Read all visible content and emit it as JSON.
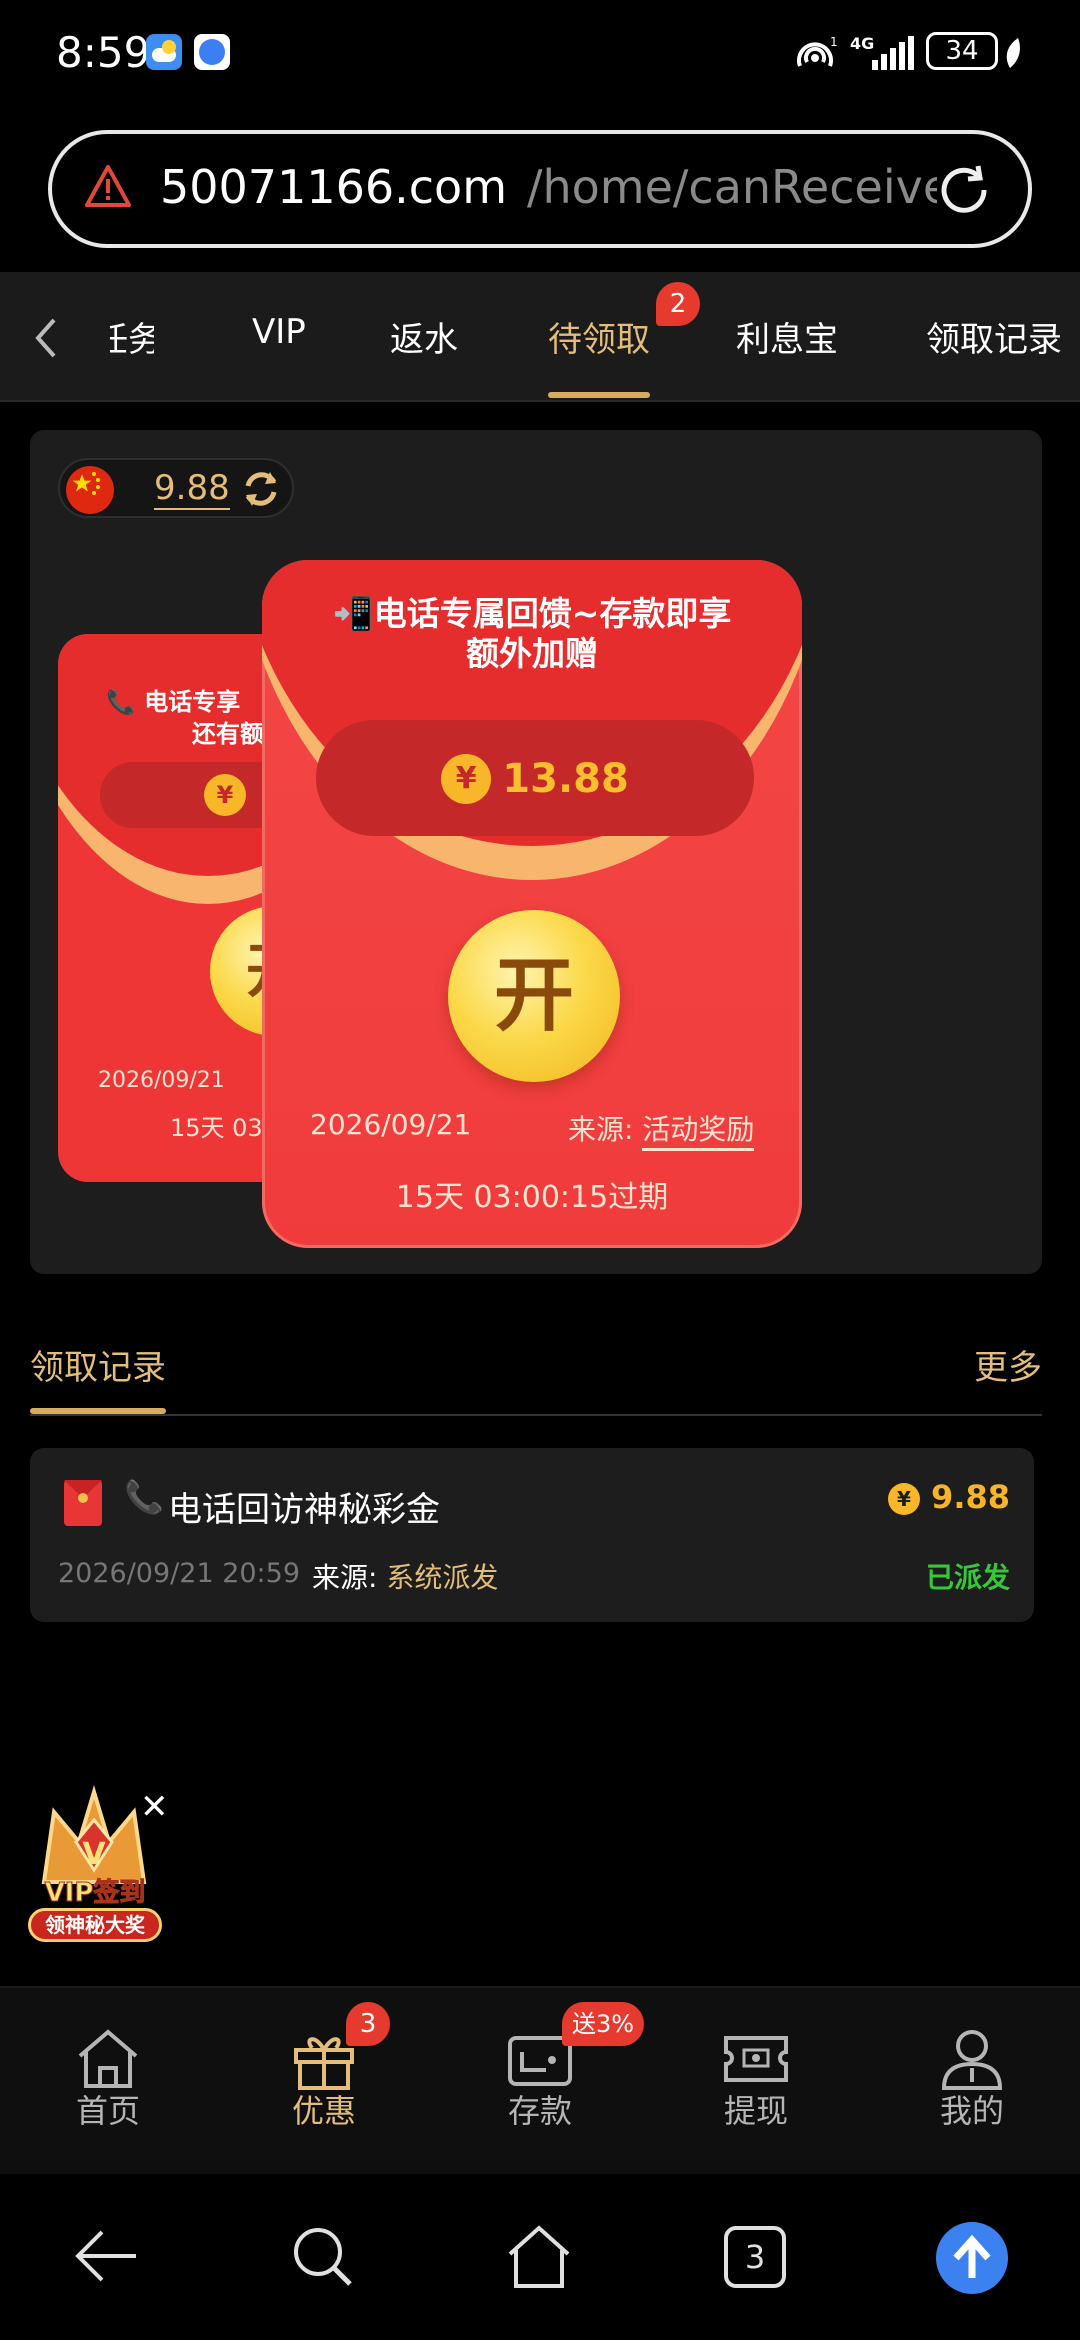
{
  "status_bar": {
    "time": "8:59",
    "network": "4G",
    "battery": "34"
  },
  "browser": {
    "url_host": "50071166.com",
    "url_path": "/home/canReceive?",
    "tab_count": "3"
  },
  "tabs": [
    {
      "label": "任务"
    },
    {
      "label": "VIP"
    },
    {
      "label": "返水"
    },
    {
      "label": "待领取",
      "badge": "2"
    },
    {
      "label": "利息宝"
    },
    {
      "label": "领取记录"
    }
  ],
  "balance": {
    "value": "9.88"
  },
  "envelope_back": {
    "title_line1": "电话专享",
    "title_line2": "还有额",
    "date": "2026/09/21",
    "expire": "15天 03",
    "open_label": "开"
  },
  "envelope_front": {
    "title_line1": "电话专属回馈~存款即享",
    "title_line2": "额外加赠",
    "amount": "13.88",
    "currency_symbol": "¥",
    "open_label": "开",
    "date": "2026/09/21",
    "source_label": "来源:",
    "source_value": "活动奖励",
    "expire_text": "15天 03:00:15过期"
  },
  "records_section": {
    "title": "领取记录",
    "more": "更多"
  },
  "record": {
    "title": "电话回访神秘彩金",
    "amount": "9.88",
    "datetime": "2026/09/21 20:59",
    "source_label": "来源:",
    "source_value": "系统派发",
    "status": "已派发"
  },
  "float_badge": {
    "line1": "VIP签到",
    "line2": "领神秘大奖"
  },
  "bottom_nav": [
    {
      "label": "首页",
      "icon": "home-icon"
    },
    {
      "label": "优惠",
      "icon": "gift-icon",
      "badge": "3"
    },
    {
      "label": "存款",
      "icon": "wallet-icon",
      "badge": "送3%"
    },
    {
      "label": "提现",
      "icon": "cash-icon"
    },
    {
      "label": "我的",
      "icon": "user-icon"
    }
  ],
  "colors": {
    "gold": "#e3bd79",
    "red": "#f03a3a",
    "green": "#35c93a"
  }
}
